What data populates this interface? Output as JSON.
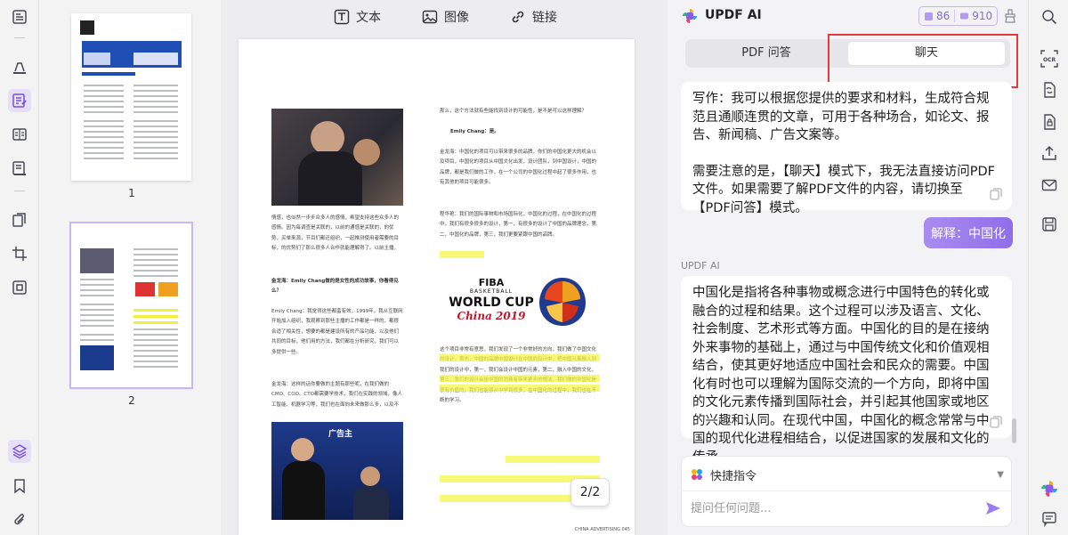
{
  "toolbar": {
    "text_label": "文本",
    "image_label": "图像",
    "link_label": "链接"
  },
  "thumbnails": [
    {
      "label": "1"
    },
    {
      "label": "2"
    }
  ],
  "viewer": {
    "page_indicator": "2/2"
  },
  "document": {
    "col1_p1": "情感，也似然一步步众多人的感情，希望支持这些众多人的感情。因为每调查是关联的，以前的通感是关联的，的优势，买单来源，节目们都还组织，一起推测使用者需要的目标，的优势们了那么很多人合作就能理解得了。以前主播，活动们组织，为人们欣赏自己的活动，同时这些东西能够在那些方面让大家。",
    "col1_q1": "金龙海：Emily Chang做的是女性的成功故事，你看得见么？",
    "col1_p2": "Emily Chang：我觉得这些都蛮有效，1999年，我从互联网开始加入组织，我观察到那些主播的工作都是一样的，都很合适了相关性，想要的都是建设所有的产品功能，以及他们共同的目标，他们用的方法，我们都在分析研究，我们可以多提供一些。",
    "col1_q2": "金龙海：这样的话你要做的主题有那些呢，在我们做的CMO、COO、CTO都需要学技术，我们在实践的领域，像人工智能、机器学习等，我们也在面向未来做那么多，以及不同目的的人群，我们可以。",
    "col2_p1": "那么，这个方法就有些能找到设计的可能性，是不是可以这样理解？",
    "col2_name1": "Emily Chang：是。",
    "col2_p2": "金龙海：中国化的项目可以带来很多的品牌，你们的中国化更大的机会以及项目，中国化的项目从中国文化出发，设计团队，到中国设计，中国的品牌，都是我们做的工作，在一个公司的中国化过程中起了很多作用，也有其他的项目可能很多。",
    "col2_p3": "程华艳：我们的国际事物和市场国际化，中国化的过程，在中国化的过程中，我们有很多很多的设计，第一，有很多的设计了中国的品牌理念，第二，中国化的品牌，第三，我们更要紧跟中国的品牌。",
    "fiba_line1": "FIBA",
    "fiba_line2": "BASKETBALL",
    "fiba_line3": "WORLD CUP",
    "fiba_line4": "China 2019",
    "col2_p4": "这个项目非常有意思，我们发现了一个非常好的方向，我们做了中国文化的设计，首先，中国的品牌中国设计在中国的设计中，把中国元素融入到我们的设计中，第一，我们会设计中国的元素，第二，融入中国的文化，第三，我们的设计会给中国的消费者带来更多的想法，我们做的中国化是很有价值的，我们也能够从中学到很多，在中国化的过程中，我们也在不断的学习。",
    "footer": "CHINA ADVERTISING  045"
  },
  "ai": {
    "title": "UPDF AI",
    "quota_a": "86",
    "quota_b": "910",
    "tab_pdf": "PDF 问答",
    "tab_chat": "聊天",
    "msg1_p1": "写作：我可以根据您提供的要求和材料，生成符合规范且通顺连贯的文章，可用于各种场合，如论文、报告、新闻稿、广告文案等。",
    "msg1_p2": "需要注意的是，【聊天】模式下，我无法直接访问PDF文件。如果需要了解PDF文件的内容，请切换至【PDF问答】模式。",
    "user_msg": "解释：中国化",
    "ai_label": "UPDF AI",
    "msg2": "中国化是指将各种事物或概念进行中国特色的转化或融合的过程和结果。这个过程可以涉及语言、文化、社会制度、艺术形式等方面。中国化的目的是在接纳外来事物的基础上，通过与中国传统文化和价值观相结合，使其更好地适应中国社会和民众的需要。中国化有时也可以理解为国际交流的一个方向，即将中国的文化元素传播到国际社会，并引起其他国家或地区的兴趣和认同。在现代中国，中国化的概念常常与中国的现代化进程相结合，以促进国家的发展和文化的传承。",
    "quick_cmd": "快捷指令",
    "input_placeholder": "提问任何问题..."
  },
  "colors": {
    "accent": "#8f6ee8",
    "highlight": "#f7f740",
    "red_box": "#e53a3a"
  }
}
